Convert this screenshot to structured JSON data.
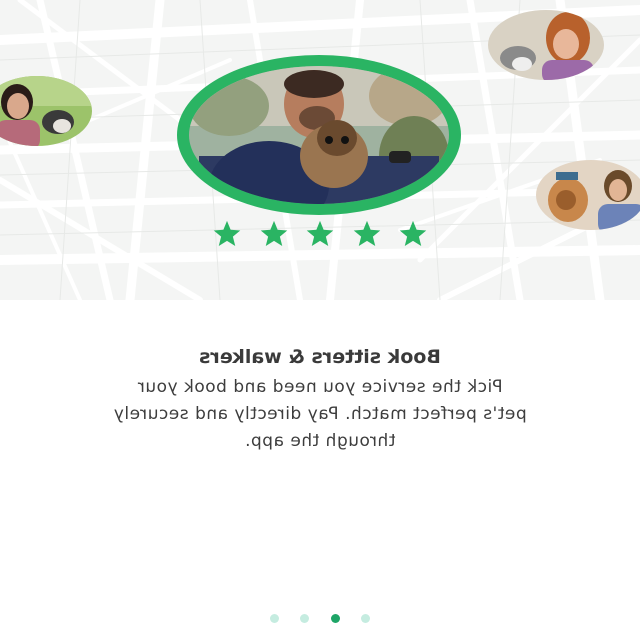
{
  "onboarding": {
    "title": "Book sitters & walkers",
    "description_lines": [
      "Pick the service you need and book your",
      "pet's perfect match. Pay directly and securely",
      "through the app."
    ],
    "rating_stars": 5,
    "page_count": 4,
    "active_page": 3
  },
  "colors": {
    "accent": "#2ab463",
    "star": "#2ab463",
    "dot_inactive": "#c5ece0",
    "dot_active": "#1ea567",
    "map_bg": "#f4f5f4",
    "map_road": "#ffffff"
  },
  "icons": [
    "star-icon"
  ],
  "images": [
    "man-with-dog-photo",
    "woman-with-dog-photo-left",
    "woman-with-dog-photo-top-right",
    "couple-with-dog-photo-right"
  ]
}
